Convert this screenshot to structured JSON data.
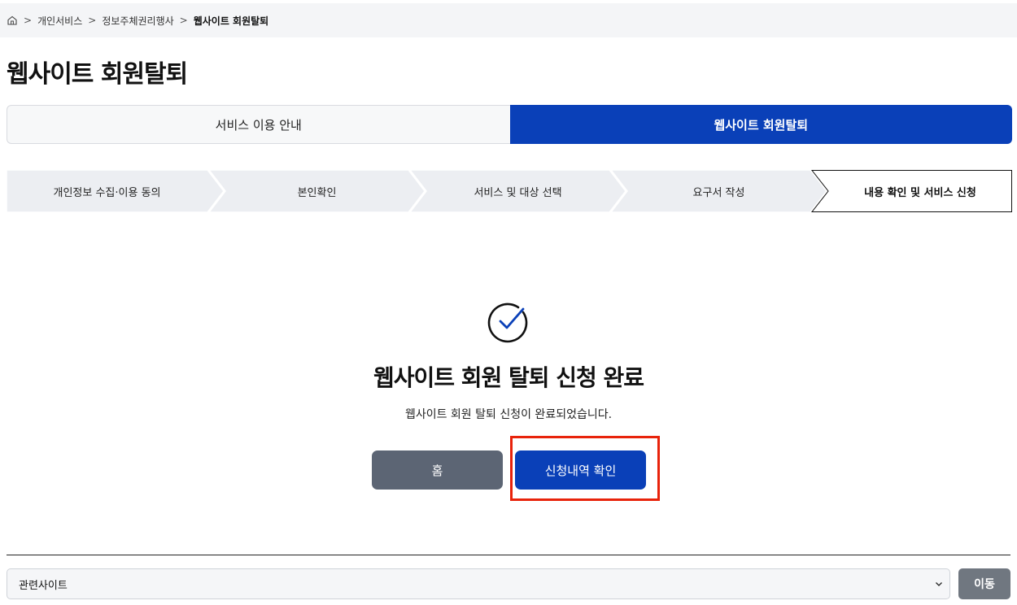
{
  "breadcrumb": {
    "items": [
      "개인서비스",
      "정보주체권리행사",
      "웹사이트 회원탈퇴"
    ]
  },
  "page_title": "웹사이트 회원탈퇴",
  "tabs": [
    {
      "label": "서비스 이용 안내",
      "active": false
    },
    {
      "label": "웹사이트 회원탈퇴",
      "active": true
    }
  ],
  "steps": [
    {
      "label": "개인정보 수집·이용 동의"
    },
    {
      "label": "본인확인"
    },
    {
      "label": "서비스 및 대상 선택"
    },
    {
      "label": "요구서 작성"
    },
    {
      "label": "내용 확인 및 서비스 신청",
      "current": true
    }
  ],
  "result": {
    "icon": "check-circle-icon",
    "title": "웹사이트 회원 탈퇴 신청 완료",
    "description": "웹사이트 회원 탈퇴 신청이 완료되었습니다."
  },
  "buttons": {
    "home": "홈",
    "history": "신청내역 확인"
  },
  "footer": {
    "related_sites": "관련사이트",
    "go": "이동"
  },
  "colors": {
    "primary": "#0a40b8",
    "secondary_button": "#5c6574",
    "highlight": "#e8230b"
  }
}
